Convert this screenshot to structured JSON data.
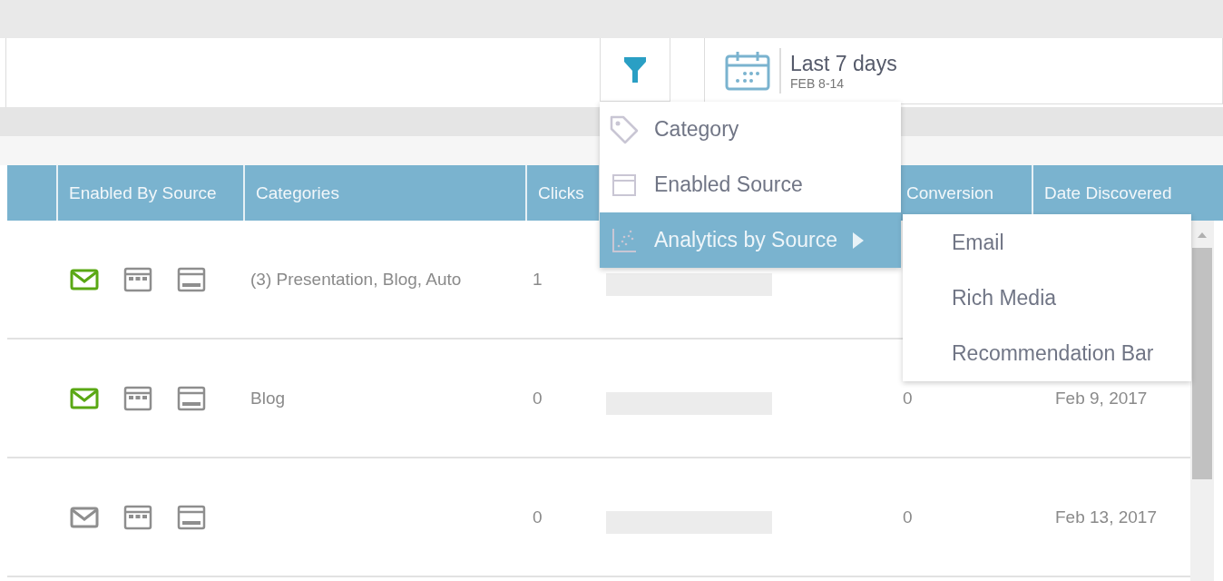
{
  "date_range": {
    "label": "Last 7 days",
    "range": "FEB 8-14"
  },
  "filter_menu": {
    "items": [
      {
        "kind": "tag",
        "label": "Category",
        "selected": false
      },
      {
        "kind": "window",
        "label": "Enabled Source",
        "selected": false
      },
      {
        "kind": "scatter",
        "label": "Analytics by Source",
        "selected": true,
        "submenu": true
      }
    ],
    "submenu": [
      "Email",
      "Rich Media",
      "Recommendation Bar"
    ]
  },
  "table": {
    "columns": [
      "Enabled By Source",
      "Categories",
      "Clicks",
      "Conversion",
      "Date Discovered"
    ],
    "rows": [
      {
        "email": true,
        "rich_media": false,
        "recommendation_bar": false,
        "categories": "(3) Presentation, Blog, Auto",
        "clicks": "1"
      },
      {
        "email": true,
        "rich_media": false,
        "recommendation_bar": false,
        "categories": "Blog",
        "clicks": "0",
        "conversion": "0",
        "date": "Feb 9, 2017"
      },
      {
        "email": false,
        "rich_media": false,
        "recommendation_bar": false,
        "clicks": "0",
        "conversion": "0",
        "date": "Feb 13, 2017"
      }
    ]
  }
}
